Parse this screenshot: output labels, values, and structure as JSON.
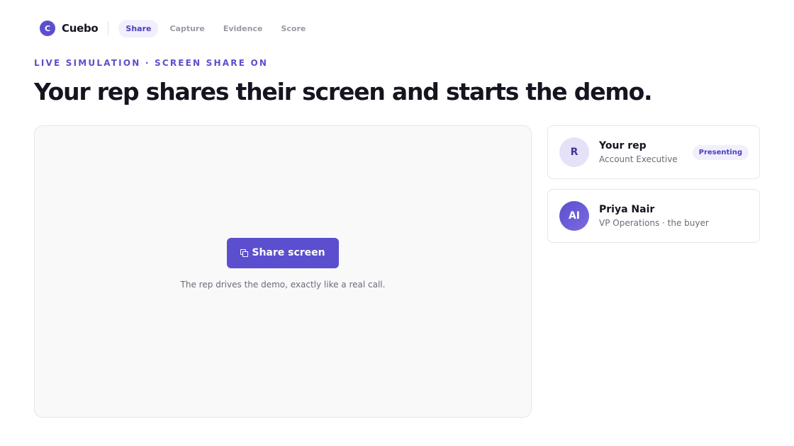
{
  "brand": {
    "logo_letter": "C",
    "name": "Cuebo"
  },
  "nav": {
    "tabs": [
      {
        "label": "Share",
        "active": true
      },
      {
        "label": "Capture",
        "active": false
      },
      {
        "label": "Evidence",
        "active": false
      },
      {
        "label": "Score",
        "active": false
      }
    ]
  },
  "header": {
    "eyebrow": "LIVE SIMULATION · SCREEN SHARE ON",
    "title": "Your rep shares their screen and starts the demo."
  },
  "stage": {
    "share_button_label": "Share screen",
    "share_button_icon": "screen-share-icon",
    "hint": "The rep drives the demo, exactly like a real call."
  },
  "participants": [
    {
      "initials": "R",
      "name": "Your rep",
      "role": "Account Executive",
      "badge": "Presenting"
    },
    {
      "initials": "AI",
      "name": "Priya Nair",
      "role": "VP Operations · the buyer"
    }
  ],
  "colors": {
    "accent": "#5b4fcf",
    "accent_light": "#f1effc",
    "text": "#15141f",
    "muted": "#6b6b78"
  }
}
